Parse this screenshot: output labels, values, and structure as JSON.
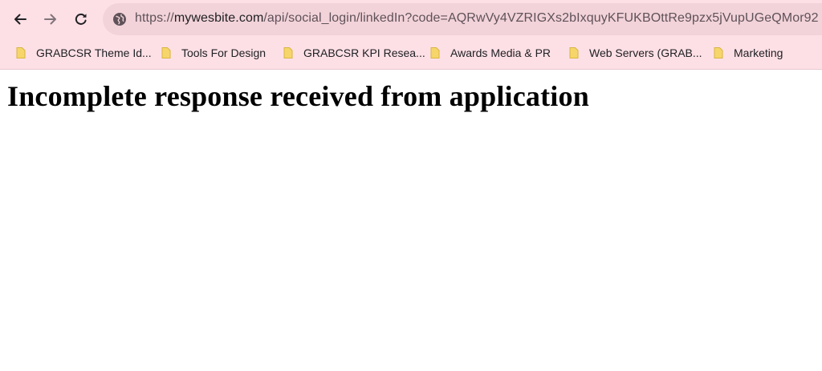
{
  "browser": {
    "address_bar": {
      "host": "mywesbite.com",
      "scheme": "https://",
      "path": "/api/social_login/linkedIn?code=AQRwVy4VZRIGXs2bIxquyKFUKBOttRe9pzx5jVupUGeQMor92"
    },
    "bookmarks": [
      {
        "label": "GRABCSR Theme Id..."
      },
      {
        "label": "Tools For Design"
      },
      {
        "label": "GRABCSR KPI Resea..."
      },
      {
        "label": "Awards Media & PR"
      },
      {
        "label": "Web Servers (GRAB..."
      },
      {
        "label": "Marketing"
      }
    ],
    "colors": {
      "chrome_background": "#fde0e6",
      "omnibox_background": "#f2d3d9",
      "folder_icon": "#f6d66a"
    }
  },
  "page": {
    "heading": "Incomplete response received from application"
  }
}
